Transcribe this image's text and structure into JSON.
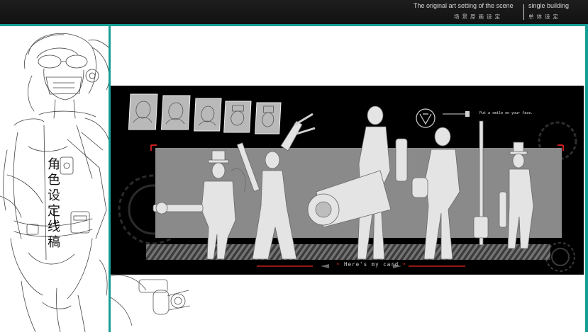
{
  "header": {
    "title_en": "The original art setting of the scene",
    "title_cn": "场景原画设定",
    "subtitle_en": "single building",
    "subtitle_cn": "单体设定"
  },
  "sidebar": {
    "vertical_title": "角色设定 线稿"
  },
  "showcase": {
    "tagline": "Put a smile on your face.",
    "caption": "Here's my card",
    "thumbnail_count": 5,
    "character_count": 5
  },
  "colors": {
    "teal_accent": "#169e95",
    "header_bg": "#161616",
    "card_bg": "#000000",
    "panel_gray": "#8a8a8a",
    "red_accent": "#c81e1e"
  }
}
